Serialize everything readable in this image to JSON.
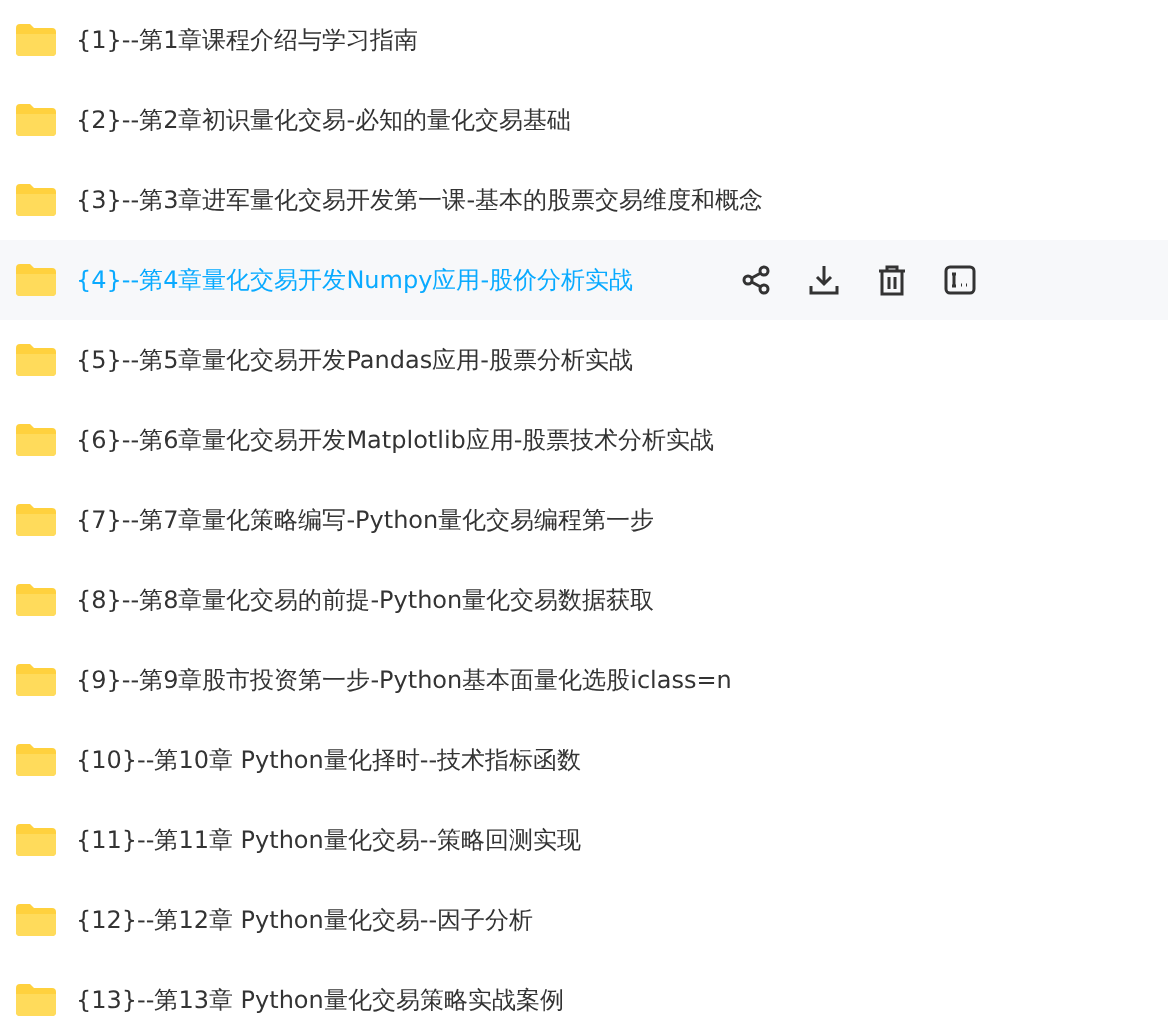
{
  "folders": [
    {
      "name": "{1}--第1章课程介绍与学习指南",
      "selected": false
    },
    {
      "name": "{2}--第2章初识量化交易-必知的量化交易基础",
      "selected": false
    },
    {
      "name": "{3}--第3章进军量化交易开发第一课-基本的股票交易维度和概念",
      "selected": false
    },
    {
      "name": "{4}--第4章量化交易开发Numpy应用-股价分析实战",
      "selected": true
    },
    {
      "name": "{5}--第5章量化交易开发Pandas应用-股票分析实战",
      "selected": false
    },
    {
      "name": "{6}--第6章量化交易开发Matplotlib应用-股票技术分析实战",
      "selected": false
    },
    {
      "name": "{7}--第7章量化策略编写-Python量化交易编程第一步",
      "selected": false
    },
    {
      "name": "{8}--第8章量化交易的前提-Python量化交易数据获取",
      "selected": false
    },
    {
      "name": "{9}--第9章股市投资第一步-Python基本面量化选股iclass=n",
      "selected": false
    },
    {
      "name": "{10}--第10章 Python量化择时--技术指标函数",
      "selected": false
    },
    {
      "name": "{11}--第11章 Python量化交易--策略回测实现",
      "selected": false
    },
    {
      "name": "{12}--第12章 Python量化交易--因子分析",
      "selected": false
    },
    {
      "name": "{13}--第13章 Python量化交易策略实战案例",
      "selected": false
    }
  ]
}
